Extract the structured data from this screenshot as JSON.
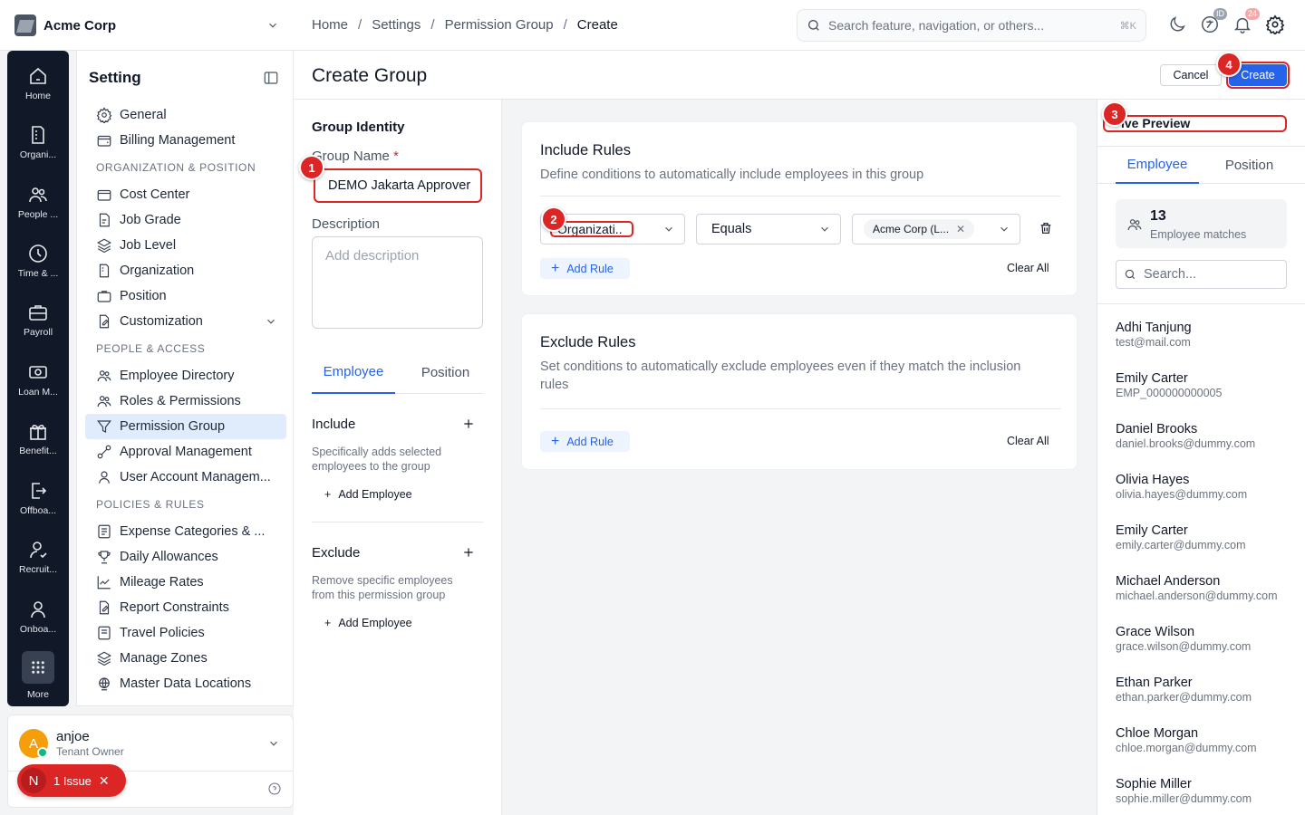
{
  "topbar": {
    "company": "Acme Corp",
    "breadcrumb": [
      "Home",
      "Settings",
      "Permission Group",
      "Create"
    ],
    "search_placeholder": "Search feature, navigation, or others...",
    "search_shortcut": "⌘K",
    "id_badge": "ID",
    "notification_count": "24"
  },
  "rail": [
    {
      "label": "Home",
      "icon": "home-icon"
    },
    {
      "label": "Organi...",
      "icon": "building-icon"
    },
    {
      "label": "People ...",
      "icon": "people-icon"
    },
    {
      "label": "Time & ...",
      "icon": "clock-icon"
    },
    {
      "label": "Payroll",
      "icon": "briefcase-icon"
    },
    {
      "label": "Loan M...",
      "icon": "cash-icon"
    },
    {
      "label": "Benefit...",
      "icon": "gift-icon"
    },
    {
      "label": "Offboa...",
      "icon": "logout-icon"
    },
    {
      "label": "Recruit...",
      "icon": "user-check-icon"
    },
    {
      "label": "Onboa...",
      "icon": "user-icon"
    },
    {
      "label": "More",
      "icon": "grid-icon"
    }
  ],
  "settings": {
    "title": "Setting",
    "items_top": [
      "General",
      "Billing Management"
    ],
    "section1": "ORGANIZATION & POSITION",
    "items_org": [
      "Cost Center",
      "Job Grade",
      "Job Level",
      "Organization",
      "Position",
      "Customization"
    ],
    "section2": "PEOPLE & ACCESS",
    "items_people": [
      "Employee Directory",
      "Roles & Permissions",
      "Permission Group",
      "Approval Management",
      "User Account Managem..."
    ],
    "section3": "POLICIES & RULES",
    "items_policies": [
      "Expense Categories & ...",
      "Daily Allowances",
      "Mileage Rates",
      "Report Constraints",
      "Travel Policies",
      "Manage Zones",
      "Master Data Locations"
    ]
  },
  "user": {
    "initial": "A",
    "name": "anjoe",
    "role": "Tenant Owner"
  },
  "issue": {
    "initial": "N",
    "label": "1 Issue"
  },
  "page": {
    "title": "Create Group",
    "cancel": "Cancel",
    "create": "Create"
  },
  "identity": {
    "heading": "Group Identity",
    "name_label": "Group Name",
    "required_mark": "*",
    "name_value": "DEMO Jakarta Approver",
    "desc_label": "Description",
    "desc_placeholder": "Add description",
    "tabs": [
      "Employee",
      "Position"
    ],
    "include_title": "Include",
    "include_desc": "Specifically adds selected employees to the group",
    "exclude_title": "Exclude",
    "exclude_desc": "Remove specific employees from this permission group",
    "add_employee": "Add Employee"
  },
  "include_rules": {
    "title": "Include Rules",
    "desc": "Define conditions to automatically include employees in this group",
    "field": "Organizati..",
    "operator": "Equals",
    "value_chip": "Acme Corp (L...",
    "add_rule": "Add Rule",
    "clear_all": "Clear All"
  },
  "exclude_rules": {
    "title": "Exclude Rules",
    "desc": "Set conditions to automatically exclude employees even if they match the inclusion rules",
    "add_rule": "Add Rule",
    "clear_all": "Clear All"
  },
  "preview": {
    "title": "ive Preview",
    "tabs": [
      "Employee",
      "Position"
    ],
    "count": "13",
    "count_label": "Employee matches",
    "search_placeholder": "Search...",
    "employees": [
      {
        "name": "Adhi Tanjung",
        "sub": "test@mail.com"
      },
      {
        "name": "Emily Carter",
        "sub": "EMP_000000000005"
      },
      {
        "name": "Daniel Brooks",
        "sub": "daniel.brooks@dummy.com"
      },
      {
        "name": "Olivia Hayes",
        "sub": "olivia.hayes@dummy.com"
      },
      {
        "name": "Emily Carter",
        "sub": "emily.carter@dummy.com"
      },
      {
        "name": "Michael Anderson",
        "sub": "michael.anderson@dummy.com"
      },
      {
        "name": "Grace Wilson",
        "sub": "grace.wilson@dummy.com"
      },
      {
        "name": "Ethan Parker",
        "sub": "ethan.parker@dummy.com"
      },
      {
        "name": "Chloe Morgan",
        "sub": "chloe.morgan@dummy.com"
      },
      {
        "name": "Sophie Miller",
        "sub": "sophie.miller@dummy.com"
      }
    ]
  },
  "steps": [
    "1",
    "2",
    "3",
    "4"
  ],
  "colors": {
    "accent": "#2563eb",
    "danger": "#dc2626",
    "rail": "#111827"
  }
}
